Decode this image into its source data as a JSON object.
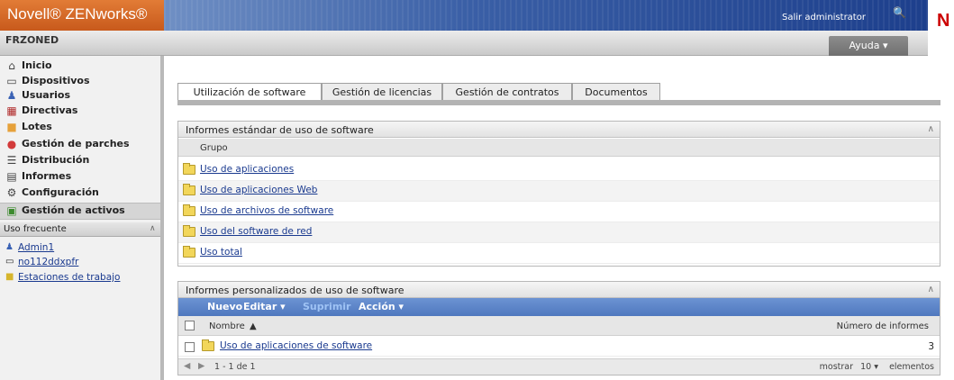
{
  "header": {
    "brand": "Novell® ZENworks®",
    "logout": "Salir administrator",
    "zone": "FRZONED",
    "help": "Ayuda ▾",
    "novell_letter": "N"
  },
  "sidebar": {
    "items": [
      {
        "label": "Inicio",
        "icon": "home-icon"
      },
      {
        "label": "Dispositivos",
        "icon": "device-icon"
      },
      {
        "label": "Usuarios",
        "icon": "users-icon"
      },
      {
        "label": "Directivas",
        "icon": "policy-icon"
      },
      {
        "label": "Lotes",
        "icon": "bundle-icon"
      },
      {
        "label": "Gestión de parches",
        "icon": "patch-icon"
      },
      {
        "label": "Distribución",
        "icon": "deployment-icon"
      },
      {
        "label": "Informes",
        "icon": "reports-icon"
      },
      {
        "label": "Configuración",
        "icon": "configuration-icon"
      },
      {
        "label": "Gestión de activos",
        "icon": "asset-management-icon"
      }
    ],
    "frequent": {
      "title": "Uso frecuente",
      "items": [
        {
          "label": "Admin1",
          "icon": "user-icon"
        },
        {
          "label": "no112ddxpfr",
          "icon": "computer-icon"
        },
        {
          "label": "Estaciones de trabajo",
          "icon": "folder-icon"
        }
      ]
    }
  },
  "tabs": [
    {
      "label": "Utilización de software",
      "active": true
    },
    {
      "label": "Gestión de licencias",
      "active": false
    },
    {
      "label": "Gestión de contratos",
      "active": false
    },
    {
      "label": "Documentos",
      "active": false
    }
  ],
  "standard_panel": {
    "title": "Informes estándar de uso de software",
    "column": "Grupo",
    "rows": [
      "Uso de aplicaciones",
      "Uso de aplicaciones Web",
      "Uso de archivos de software",
      "Uso del software de red",
      "Uso total"
    ]
  },
  "custom_panel": {
    "title": "Informes personalizados de uso de software",
    "toolbar": {
      "new": "Nuevo",
      "edit": "Editar ▾",
      "delete": "Suprimir",
      "action": "Acción ▾"
    },
    "columns": {
      "name": "Nombre",
      "sort_indicator": "▲",
      "count": "Número de informes"
    },
    "rows": [
      {
        "name": "Uso de aplicaciones de software",
        "count": "3"
      }
    ],
    "pager": {
      "range": "1 - 1 de 1",
      "show_prefix": "mostrar",
      "page_size": "10 ▾",
      "show_suffix": "elementos"
    }
  }
}
